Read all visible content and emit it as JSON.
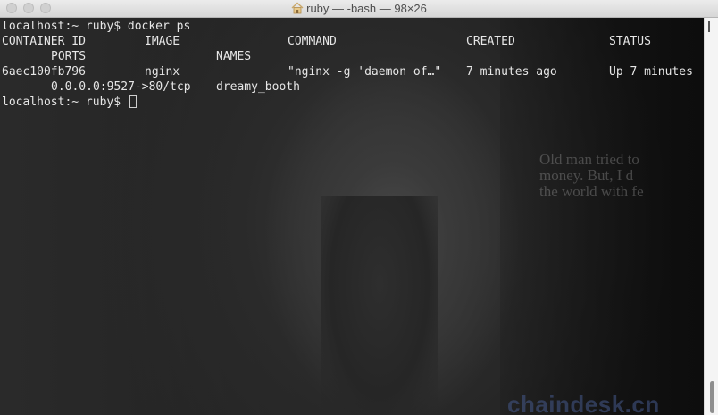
{
  "window": {
    "title": "ruby — -bash — 98×26",
    "title_icon": "home-icon"
  },
  "terminal": {
    "prompt1": "localhost:~ ruby$ docker ps",
    "header": {
      "container_id": "CONTAINER ID",
      "image": "IMAGE",
      "command": "COMMAND",
      "created": "CREATED",
      "status": "STATUS",
      "ports": "PORTS",
      "names": "NAMES"
    },
    "row": {
      "container_id": "6aec100fb796",
      "image": "nginx",
      "command": "\"nginx -g 'daemon of…\"",
      "created": "7 minutes ago",
      "status": "Up 7 minutes",
      "ports": "0.0.0.0:9527->80/tcp",
      "names": "dreamy_booth"
    },
    "prompt2": "localhost:~ ruby$ "
  },
  "background": {
    "quote_lines": [
      "Old man tried to",
      "money. But, I d",
      "the world with fe"
    ],
    "brand": "chaindesk.cn"
  }
}
